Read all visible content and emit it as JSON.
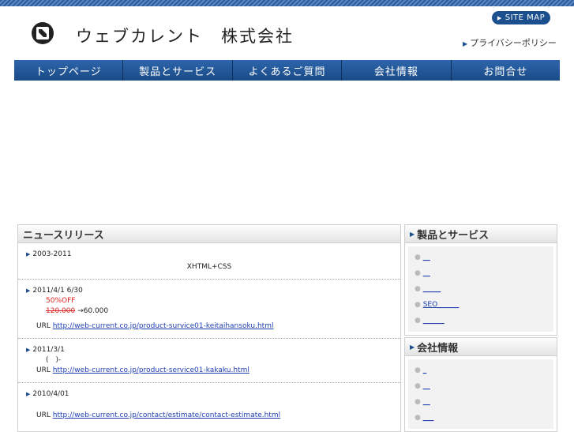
{
  "header": {
    "company_name": "ウェブカレント　株式会社",
    "sitemap_label": "SITE MAP",
    "privacy_label": "プライバシーポリシー"
  },
  "nav": [
    "トップページ",
    "製品とサービス",
    "よくあるご質問",
    "会社情報",
    "お問合せ"
  ],
  "news": {
    "title": "ニュースリリース",
    "entries": [
      {
        "date": "2003-2011",
        "line": "XHTML+CSS"
      },
      {
        "date": "2011/4/1 6/30",
        "discount": "50%OFF",
        "old_price": "120.000",
        "arrow": "→60.000",
        "url_label": "URL",
        "url": "http://web-current.co.jp/product-survice01-keitaihansoku.html"
      },
      {
        "date": "2011/3/1",
        "note": "(　)-",
        "url_label": "URL",
        "url": "http://web-current.co.jp/product-service01-kakaku.html"
      },
      {
        "date": "2010/4/01",
        "url_label": "URL",
        "url": "http://web-current.co.jp/contact/estimate/contact-estimate.html"
      }
    ]
  },
  "side1": {
    "title": "製品とサービス",
    "items": [
      "__",
      "__",
      "_____",
      "SEO______",
      "______"
    ]
  },
  "side2": {
    "title": "会社情報",
    "items": [
      "_",
      "__",
      "__",
      "___"
    ]
  }
}
